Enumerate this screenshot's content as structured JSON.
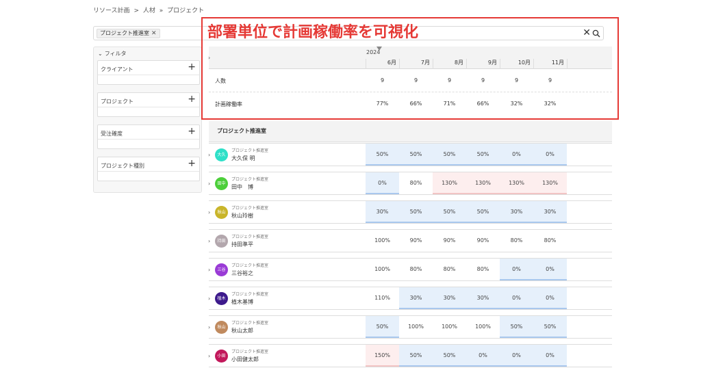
{
  "breadcrumb": [
    "リソース計画",
    ">",
    "人材",
    "»",
    "プロジェクト"
  ],
  "search": {
    "chip_label": "プロジェクト推進室",
    "chip_remove": "✕",
    "clear": "✕"
  },
  "filters": {
    "title": "フィルタ",
    "toggle": "⌄",
    "items": [
      {
        "label": "クライアント",
        "plus": "+"
      },
      {
        "label": "プロジェクト",
        "plus": "+"
      },
      {
        "label": "受注確度",
        "plus": "+"
      },
      {
        "label": "プロジェクト種別",
        "plus": "+"
      }
    ]
  },
  "overlay_title": "部署単位で計画稼働率を可視化",
  "timeline": {
    "year": "2024",
    "months": [
      "6月",
      "7月",
      "8月",
      "9月",
      "10月",
      "11月"
    ]
  },
  "summary": {
    "headcount_label": "人数",
    "headcount": [
      "9",
      "9",
      "9",
      "9",
      "9",
      "9"
    ],
    "rate_label": "計画稼働率",
    "rates": [
      "77%",
      "66%",
      "71%",
      "66%",
      "32%",
      "32%"
    ]
  },
  "department": "プロジェクト推進室",
  "people": [
    {
      "avatar": "大久",
      "avatar_color": "#2ee0c8",
      "dept": "プロジェクト推進室",
      "name": "大久保 明",
      "values": [
        "50%",
        "50%",
        "50%",
        "50%",
        "0%",
        "0%"
      ],
      "states": [
        "blue",
        "blue",
        "blue",
        "blue",
        "blue",
        "blue"
      ]
    },
    {
      "avatar": "田中",
      "avatar_color": "#4ccf3a",
      "dept": "プロジェクト推進室",
      "name": "田中　博",
      "values": [
        "0%",
        "80%",
        "130%",
        "130%",
        "130%",
        "130%"
      ],
      "states": [
        "blue",
        "none",
        "pink",
        "pink",
        "pink",
        "pink"
      ]
    },
    {
      "avatar": "秋山",
      "avatar_color": "#c9b52a",
      "dept": "プロジェクト推進室",
      "name": "秋山玲樹",
      "values": [
        "30%",
        "50%",
        "50%",
        "50%",
        "30%",
        "30%"
      ],
      "states": [
        "blue",
        "blue",
        "blue",
        "blue",
        "blue",
        "blue"
      ]
    },
    {
      "avatar": "持田",
      "avatar_color": "#b3a7ad",
      "dept": "プロジェクト推進室",
      "name": "持田準平",
      "values": [
        "100%",
        "90%",
        "90%",
        "90%",
        "80%",
        "80%"
      ],
      "states": [
        "none",
        "none",
        "none",
        "none",
        "none",
        "none"
      ]
    },
    {
      "avatar": "三谷",
      "avatar_color": "#9a3bd6",
      "dept": "プロジェクト推進室",
      "name": "三谷裕之",
      "values": [
        "100%",
        "80%",
        "80%",
        "80%",
        "0%",
        "0%"
      ],
      "states": [
        "none",
        "none",
        "none",
        "none",
        "blue",
        "blue"
      ]
    },
    {
      "avatar": "植木",
      "avatar_color": "#3d1a8c",
      "dept": "プロジェクト推進室",
      "name": "植木基博",
      "values": [
        "110%",
        "30%",
        "30%",
        "30%",
        "0%",
        "0%"
      ],
      "states": [
        "none",
        "blue",
        "blue",
        "blue",
        "blue",
        "blue"
      ]
    },
    {
      "avatar": "秋山",
      "avatar_color": "#c08a5e",
      "dept": "プロジェクト推進室",
      "name": "秋山太郎",
      "values": [
        "50%",
        "100%",
        "100%",
        "100%",
        "50%",
        "50%"
      ],
      "states": [
        "blue",
        "none",
        "none",
        "none",
        "blue",
        "blue"
      ]
    },
    {
      "avatar": "小田",
      "avatar_color": "#c2185b",
      "dept": "プロジェクト推進室",
      "name": "小田健太郎",
      "values": [
        "150%",
        "50%",
        "50%",
        "0%",
        "0%",
        "0%"
      ],
      "states": [
        "pink",
        "blue",
        "blue",
        "blue",
        "blue",
        "blue"
      ]
    }
  ]
}
